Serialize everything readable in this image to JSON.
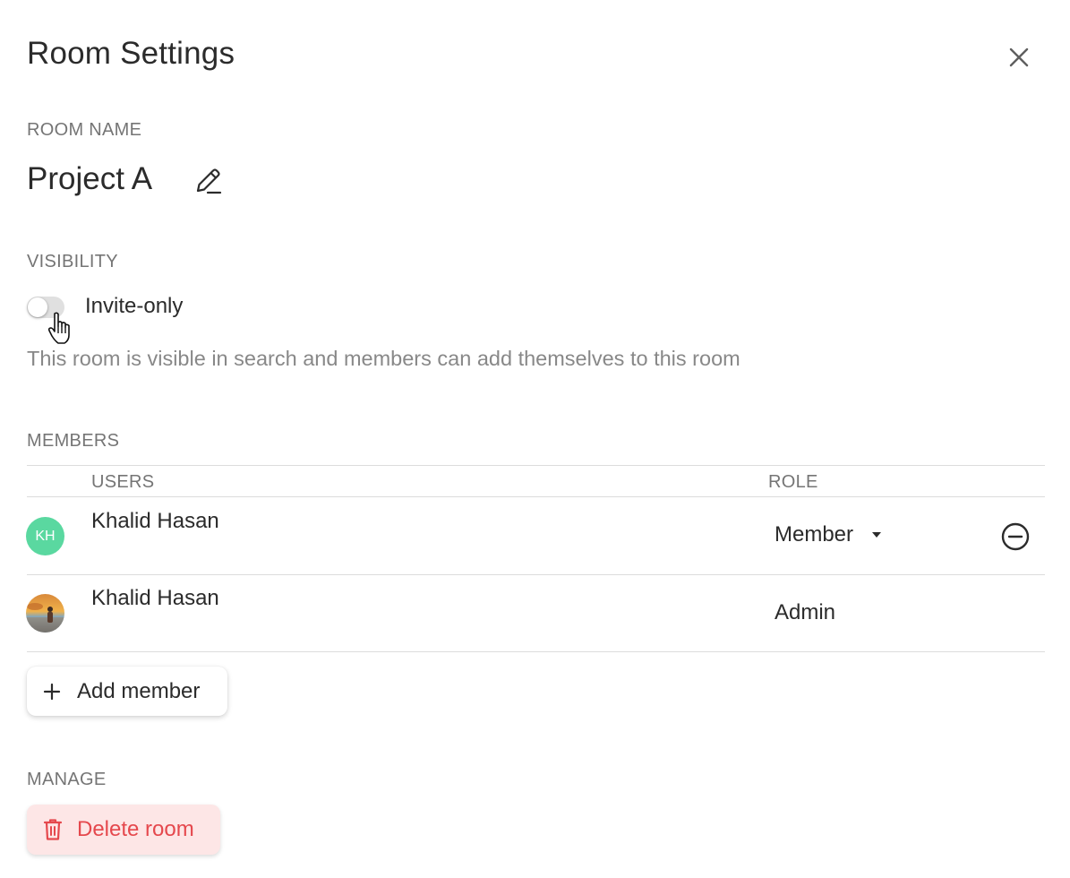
{
  "dialog": {
    "title": "Room Settings",
    "close_icon": "close-icon"
  },
  "room_name": {
    "label": "ROOM NAME",
    "value": "Project A",
    "edit_icon": "pencil-icon"
  },
  "visibility": {
    "label": "VISIBILITY",
    "toggle_label": "Invite-only",
    "toggle_on": false,
    "description": "This room is visible in search and members can add themselves to this room"
  },
  "members": {
    "label": "MEMBERS",
    "columns": {
      "users": "USERS",
      "role": "ROLE"
    },
    "rows": [
      {
        "initials": "KH",
        "avatar_color": "#5ad8a0",
        "name": "Khalid Hasan",
        "role": "Member",
        "role_editable": true,
        "remove_icon": "minus-circle-icon"
      },
      {
        "initials": "",
        "avatar": "photo",
        "name": "Khalid Hasan",
        "role": "Admin",
        "role_editable": false
      }
    ],
    "add_button": {
      "label": "Add member",
      "icon": "plus-icon"
    }
  },
  "manage": {
    "label": "MANAGE",
    "delete_button": {
      "label": "Delete room",
      "icon": "trash-icon",
      "color": "#e5484d",
      "background": "#fde6e6"
    }
  }
}
